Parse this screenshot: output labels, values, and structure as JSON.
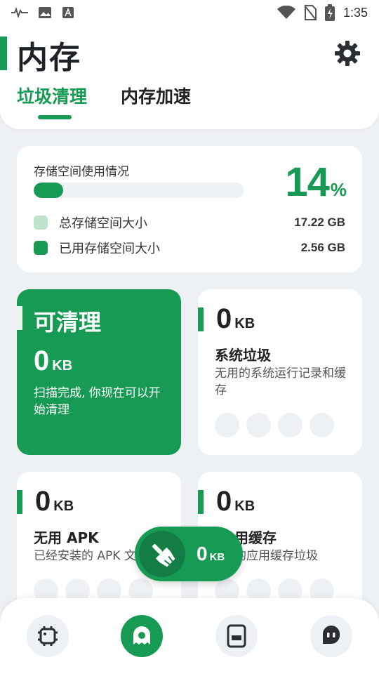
{
  "status_bar": {
    "time": "1:35",
    "icons": [
      "pulse-icon",
      "image-icon",
      "font-icon",
      "wifi-icon",
      "no-sim-icon",
      "battery-charging-icon"
    ]
  },
  "header": {
    "title": "内存",
    "settings_icon": "gear-icon"
  },
  "tabs": [
    {
      "label": "垃圾清理",
      "active": true
    },
    {
      "label": "内存加速",
      "active": false
    }
  ],
  "storage": {
    "label": "存储空间使用情况",
    "percent": "14",
    "percent_symbol": "%",
    "fill_fraction": 0.14,
    "total_label": "总存储空间大小",
    "total_value": "17.22 GB",
    "used_label": "已用存储空间大小",
    "used_value": "2.56 GB"
  },
  "cleanable": {
    "title": "可清理",
    "size": "0",
    "unit": "KB",
    "description": "扫描完成, 你现在可以开始清理"
  },
  "categories": [
    {
      "size": "0",
      "unit": "KB",
      "name": "系统垃圾",
      "description": "无用的系统运行记录和缓存"
    },
    {
      "size": "0",
      "unit": "KB",
      "name": "无用 APK",
      "description": "已经安装的 APK 文"
    },
    {
      "size": "0",
      "unit": "KB",
      "name": "用缓存",
      "description": "的应用缓存垃圾"
    }
  ],
  "floating_button": {
    "size": "0",
    "unit": "KB",
    "icon": "broom-icon"
  },
  "bottom_nav": [
    {
      "icon": "chip-icon",
      "active": false
    },
    {
      "icon": "ghost-icon",
      "active": true
    },
    {
      "icon": "storage-icon",
      "active": false
    },
    {
      "icon": "chat-icon",
      "active": false
    }
  ],
  "colors": {
    "accent": "#179a53",
    "accent_light": "#bfe3cd",
    "background": "#eef1f4"
  }
}
